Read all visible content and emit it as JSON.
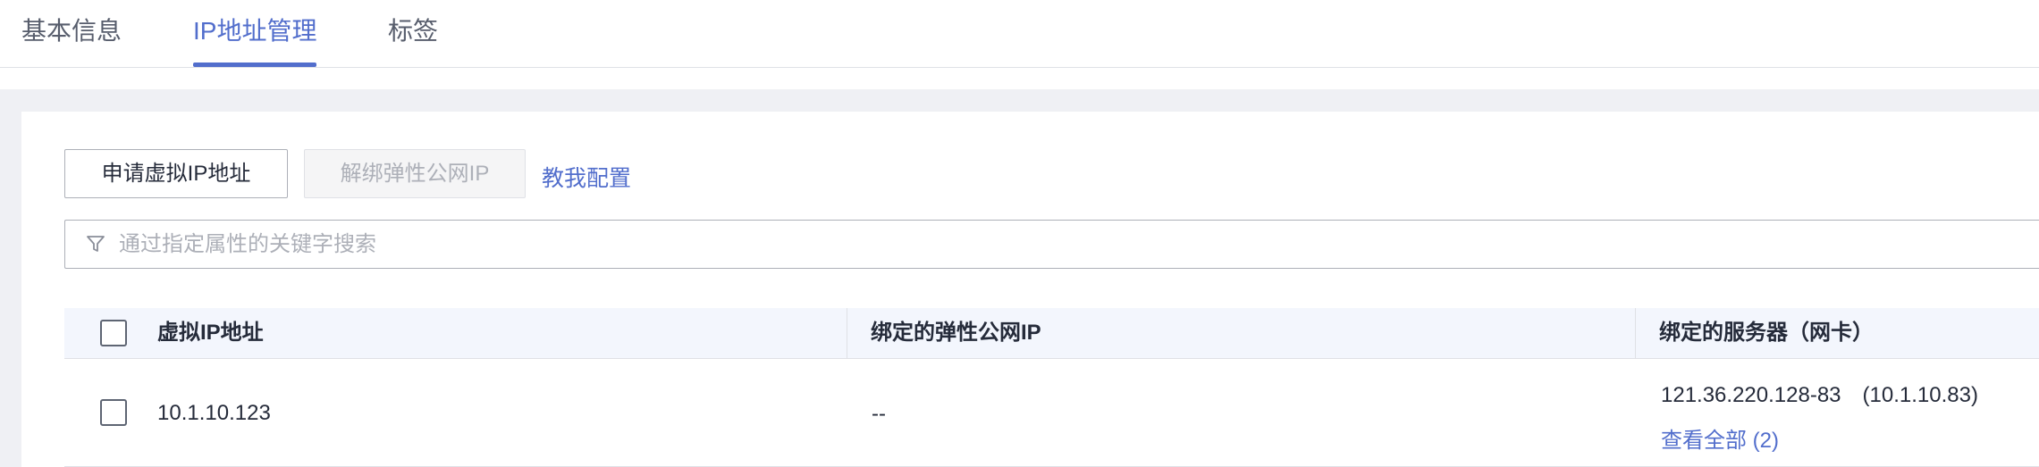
{
  "tabs": [
    {
      "label": "基本信息",
      "active": false
    },
    {
      "label": "IP地址管理",
      "active": true
    },
    {
      "label": "标签",
      "active": false
    }
  ],
  "toolbar": {
    "apply_label": "申请虚拟IP地址",
    "unbind_label": "解绑弹性公网IP",
    "help_link": "教我配置"
  },
  "search": {
    "placeholder": "通过指定属性的关键字搜索",
    "icon": "filter-icon"
  },
  "table": {
    "headers": {
      "virtual_ip": "虚拟IP地址",
      "eip": "绑定的弹性公网IP",
      "server": "绑定的服务器（网卡）"
    },
    "rows": [
      {
        "virtual_ip": "10.1.10.123",
        "eip": "--",
        "server": "121.36.220.128-83　(10.1.10.83)",
        "view_all": "查看全部 (2)"
      }
    ]
  },
  "colors": {
    "accent": "#526ecc",
    "page_bg": "#eff0f4",
    "header_bg": "#f3f6fd",
    "border": "#dfe1e6"
  }
}
